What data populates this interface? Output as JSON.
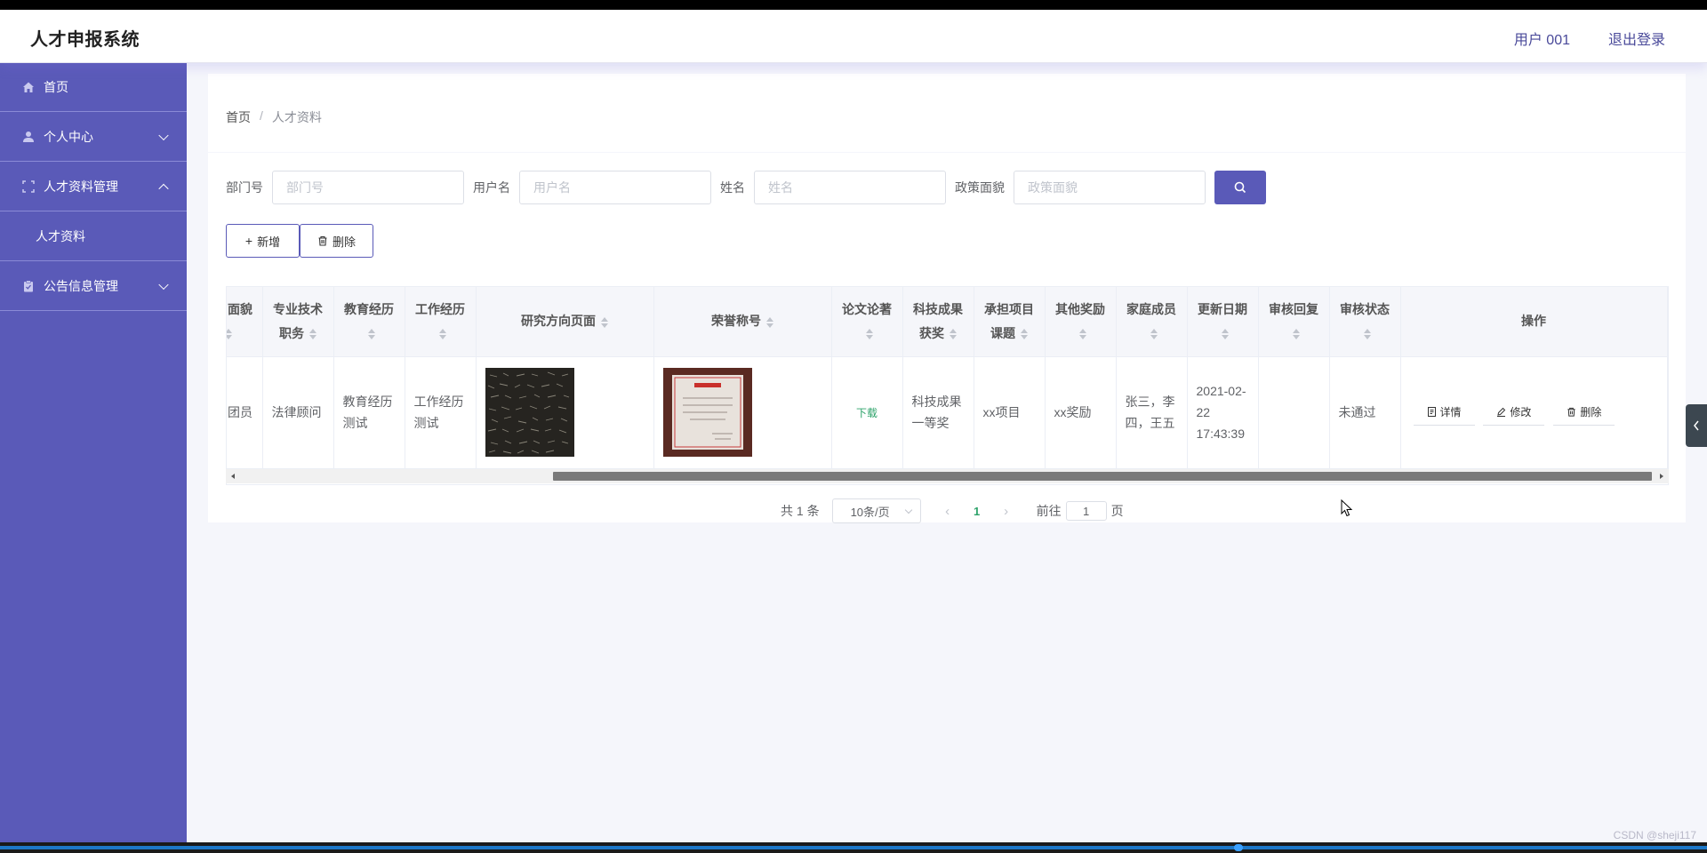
{
  "header": {
    "title": "人才申报系统",
    "user": "用户 001",
    "logout": "退出登录"
  },
  "sidebar": {
    "items": [
      {
        "label": "首页",
        "icon": "home-icon"
      },
      {
        "label": "个人中心",
        "icon": "user-icon"
      },
      {
        "label": "人才资料管理",
        "icon": "fullscreen-icon",
        "expanded": true,
        "children": [
          "人才资料"
        ]
      },
      {
        "label": "公告信息管理",
        "icon": "clipboard-icon"
      }
    ]
  },
  "breadcrumb": {
    "home": "首页",
    "separator": "/",
    "current": "人才资料"
  },
  "search": {
    "fields": [
      {
        "label": "部门号",
        "placeholder": "部门号",
        "value": ""
      },
      {
        "label": "用户名",
        "placeholder": "用户名",
        "value": ""
      },
      {
        "label": "姓名",
        "placeholder": "姓名",
        "value": ""
      },
      {
        "label": "政策面貌",
        "placeholder": "政策面貌",
        "value": ""
      }
    ],
    "button_icon": "search-icon"
  },
  "toolbar": {
    "add_label": "新增",
    "delete_label": "删除"
  },
  "table": {
    "columns": [
      "面貌",
      "专业技术职务",
      "教育经历",
      "工作经历",
      "研究方向页面",
      "荣誉称号",
      "论文论著",
      "科技成果获奖",
      "承担项目课题",
      "其他奖励",
      "家庭成员",
      "更新日期",
      "审核回复",
      "审核状态",
      "操作"
    ],
    "rows": [
      {
        "politics": "团员",
        "title": "法律顾问",
        "education": "教育经历测试",
        "work": "工作经历测试",
        "research_image": "image",
        "honor_image": "image",
        "paper": "下载",
        "achievement": "科技成果一等奖",
        "project": "xx项目",
        "other_award": "xx奖励",
        "family": "张三，李四，王五",
        "updated": "2021-02-22 17:43:39",
        "reply": "",
        "status": "未通过",
        "actions": [
          "详情",
          "修改",
          "删除"
        ]
      }
    ]
  },
  "pagination": {
    "total_text": "共 1 条",
    "page_size": "10条/页",
    "current_page": "1",
    "goto_prefix": "前往",
    "goto_value": "1",
    "goto_suffix": "页"
  },
  "footer": {
    "watermark": "CSDN @sheji117"
  },
  "colors": {
    "accent": "#5a5ab8",
    "link": "#2fa36b"
  }
}
